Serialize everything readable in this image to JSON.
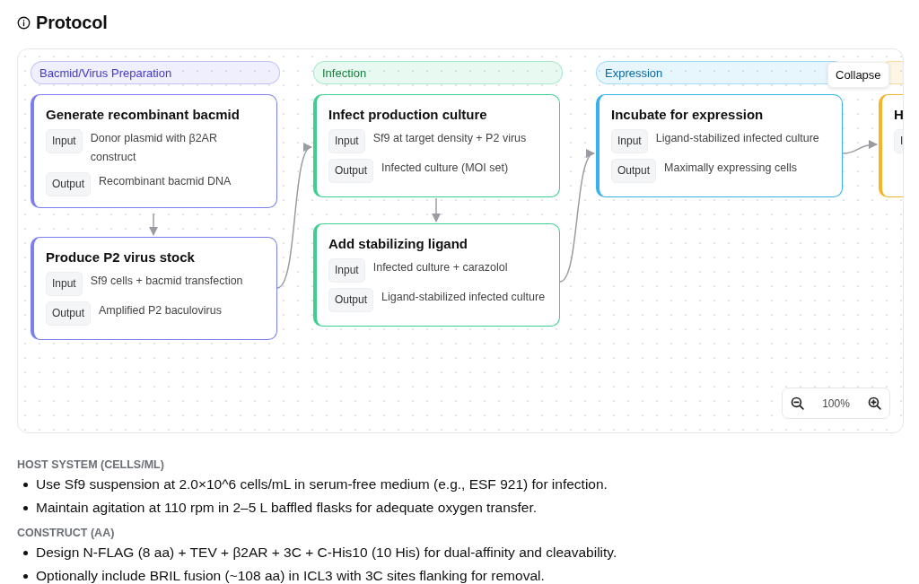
{
  "title": "Protocol",
  "lanes": [
    {
      "label": "Bacmid/Virus Preparation",
      "color": "#7b7ff0",
      "nodes": [
        {
          "title": "Generate recombinant bacmid",
          "rows": [
            {
              "tag": "Input",
              "text": "Donor plasmid with β2AR construct"
            },
            {
              "tag": "Output",
              "text": "Recombinant bacmid DNA"
            }
          ]
        },
        {
          "title": "Produce P2 virus stock",
          "rows": [
            {
              "tag": "Input",
              "text": "Sf9 cells + bacmid transfection"
            },
            {
              "tag": "Output",
              "text": "Amplified P2 baculovirus"
            }
          ]
        }
      ]
    },
    {
      "label": "Infection",
      "color": "#3ccf8e",
      "nodes": [
        {
          "title": "Infect production culture",
          "rows": [
            {
              "tag": "Input",
              "text": "Sf9 at target density + P2 virus"
            },
            {
              "tag": "Output",
              "text": "Infected culture (MOI set)"
            }
          ]
        },
        {
          "title": "Add stabilizing ligand",
          "rows": [
            {
              "tag": "Input",
              "text": "Infected culture + carazolol"
            },
            {
              "tag": "Output",
              "text": "Ligand-stabilized infected culture"
            }
          ]
        }
      ]
    },
    {
      "label": "Expression",
      "color": "#38b2ec",
      "nodes": [
        {
          "title": "Incubate for expression",
          "rows": [
            {
              "tag": "Input",
              "text": "Ligand-stabilized infected culture"
            },
            {
              "tag": "Output",
              "text": "Maximally expressing cells"
            }
          ]
        }
      ]
    },
    {
      "color": "#f5b528",
      "nodes": [
        {
          "title": "H",
          "rows": [
            {
              "tag": "I"
            }
          ]
        }
      ]
    }
  ],
  "collapse_button": "Collapse",
  "zoom": {
    "value": "100%"
  },
  "sections": [
    {
      "heading": "HOST SYSTEM (CELLS/ML)",
      "items": [
        "Use Sf9 suspension at 2.0×10^6 cells/mL in serum-free medium (e.g., ESF 921) for infection.",
        "Maintain agitation at 110 rpm in 2–5 L baffled flasks for adequate oxygen transfer."
      ]
    },
    {
      "heading": "CONSTRUCT (AA)",
      "items": [
        "Design N-FLAG (8 aa) + TEV + β2AR + 3C + C-His10 (10 His) for dual-affinity and cleavability.",
        "Optionally include BRIL fusion (~108 aa) in ICL3 with 3C sites flanking for removal."
      ]
    }
  ]
}
